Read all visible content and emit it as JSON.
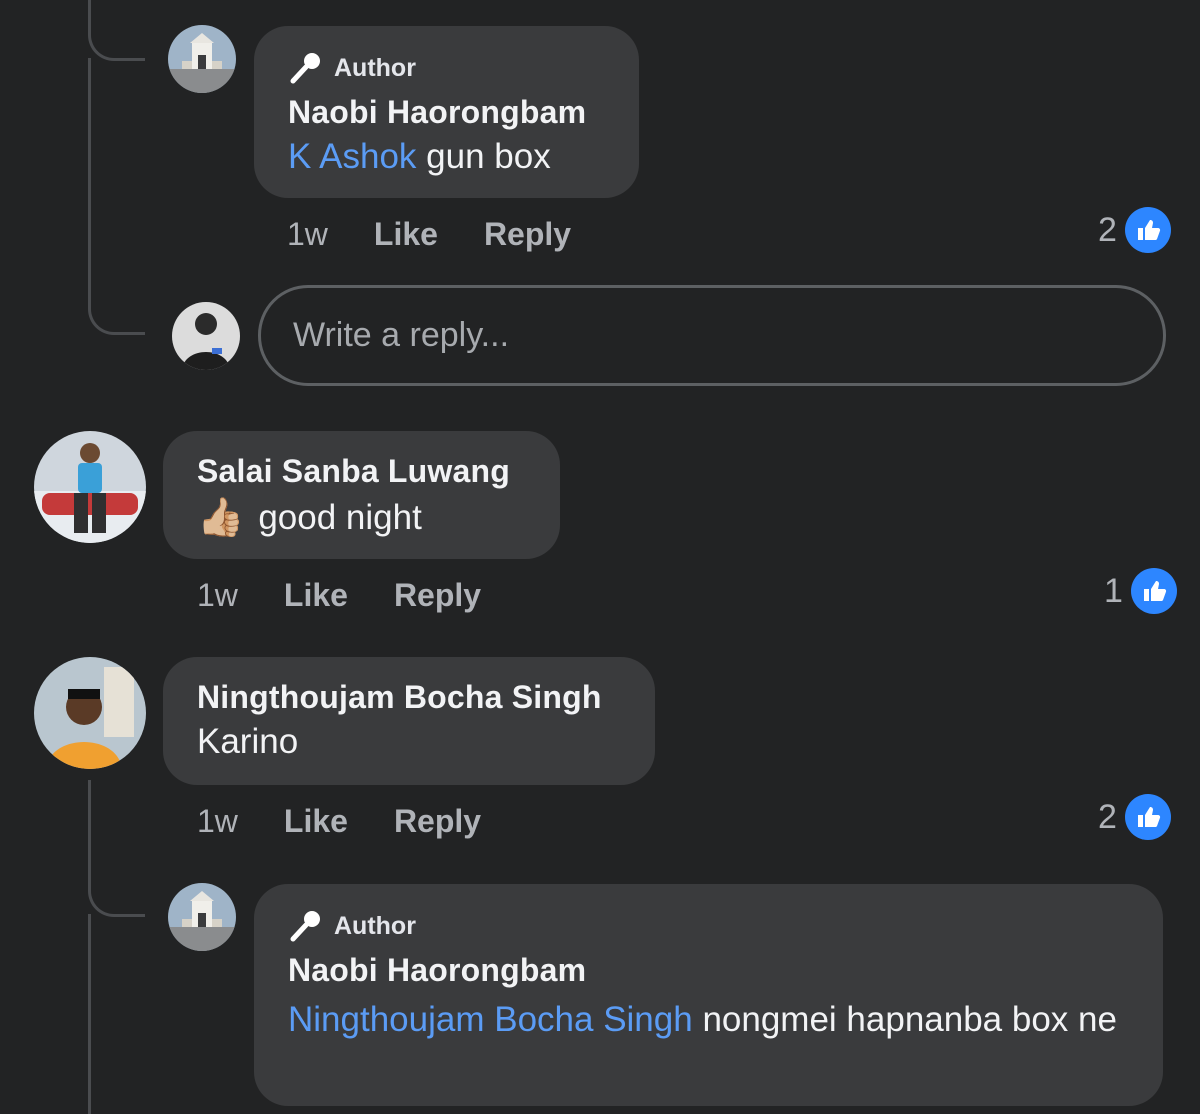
{
  "comments": [
    {
      "author_badge": "Author",
      "name": "Naobi Haorongbam",
      "mention": "K Ashok",
      "text": " gun box",
      "time": "1w",
      "like_label": "Like",
      "reply_label": "Reply",
      "reaction_count": "2",
      "avatar_icon": "building-photo-avatar"
    },
    {
      "name": "Salai Sanba Luwang",
      "emoji": "👍🏼",
      "text": "good night",
      "time": "1w",
      "like_label": "Like",
      "reply_label": "Reply",
      "reaction_count": "1",
      "avatar_icon": "man-with-car-avatar"
    },
    {
      "name": "Ningthoujam Bocha Singh",
      "text": "Karino",
      "time": "1w",
      "like_label": "Like",
      "reply_label": "Reply",
      "reaction_count": "2",
      "avatar_icon": "man-portrait-avatar"
    },
    {
      "author_badge": "Author",
      "name": "Naobi Haorongbam",
      "mention": "Ningthoujam Bocha Singh",
      "text": " nongmei hapnanba box ne",
      "avatar_icon": "building-photo-avatar"
    }
  ],
  "reply_box": {
    "placeholder": "Write a reply..."
  },
  "colors": {
    "background": "#222324",
    "bubble": "#3a3b3d",
    "mention": "#5b9cf5",
    "like_badge": "#2d86ff"
  }
}
